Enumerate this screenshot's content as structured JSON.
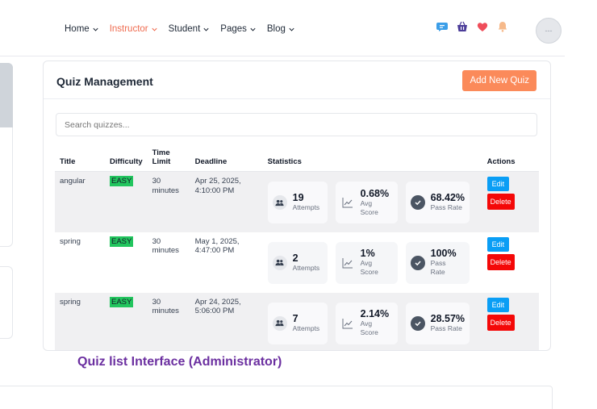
{
  "nav": {
    "items": [
      {
        "label": "Home",
        "active": false
      },
      {
        "label": "Instructor",
        "active": true
      },
      {
        "label": "Student",
        "active": false
      },
      {
        "label": "Pages",
        "active": false
      },
      {
        "label": "Blog",
        "active": false
      }
    ],
    "icons": [
      "chat-icon",
      "basket-icon",
      "heart-icon",
      "bell-icon"
    ],
    "avatar_text": "---"
  },
  "card": {
    "title": "Quiz Management",
    "add_label": "Add New Quiz",
    "search_placeholder": "Search quizzes..."
  },
  "table": {
    "headers": {
      "title": "Title",
      "difficulty": "Difficulty",
      "time_limit_1": "Time",
      "time_limit_2": "Limit",
      "deadline": "Deadline",
      "statistics": "Statistics",
      "actions": "Actions"
    },
    "rows": [
      {
        "title": "angular",
        "difficulty": "EASY",
        "time": "30",
        "time_unit": "minutes",
        "deadline_1": "Apr 25, 2025,",
        "deadline_2": "4:10:00 PM",
        "attempts": "19",
        "attempts_label": "Attempts",
        "avg": "0.68%",
        "avg_label_1": "Avg",
        "avg_label_2": "Score",
        "pass": "68.42%",
        "pass_label": "Pass Rate"
      },
      {
        "title": "spring",
        "difficulty": "EASY",
        "time": "30",
        "time_unit": "minutes",
        "deadline_1": "May 1, 2025,",
        "deadline_2": "4:47:00 PM",
        "attempts": "2",
        "attempts_label": "Attempts",
        "avg": "1%",
        "avg_label_1": "Avg",
        "avg_label_2": "Score",
        "pass": "100%",
        "pass_label": "Pass Rate"
      },
      {
        "title": "spring",
        "difficulty": "EASY",
        "time": "30",
        "time_unit": "minutes",
        "deadline_1": "Apr 24, 2025,",
        "deadline_2": "5:06:00 PM",
        "attempts": "7",
        "attempts_label": "Attempts",
        "avg": "2.14%",
        "avg_label_1": "Avg",
        "avg_label_2": "Score",
        "pass": "28.57%",
        "pass_label": "Pass Rate"
      }
    ],
    "edit_label": "Edit",
    "delete_label": "Delete"
  },
  "caption": "Quiz list Interface (Administrator)",
  "colors": {
    "accent": "#ef6b4f",
    "add_button": "#fb8a5a",
    "easy_badge": "#22c55e",
    "edit": "#0a9ef5",
    "delete": "#f40808",
    "caption": "#6b2fa0"
  }
}
